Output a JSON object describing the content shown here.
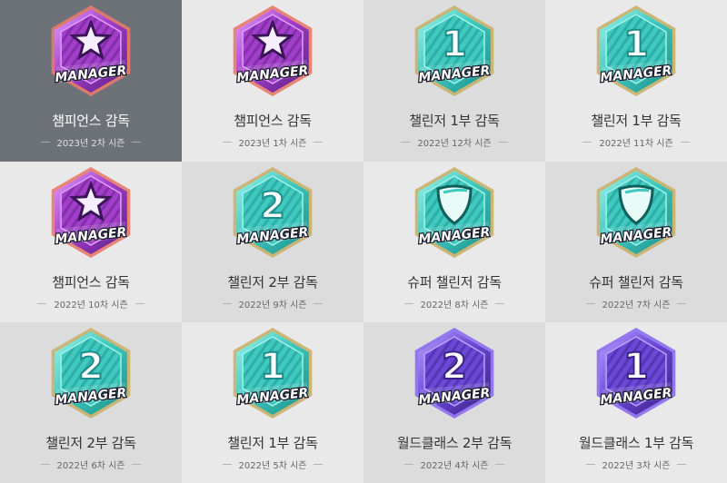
{
  "badges": [
    {
      "title": "챔피언스 감독",
      "season": "2023년 2차 시즌",
      "tier": "champions",
      "emblem": "star",
      "selected": true
    },
    {
      "title": "챔피언스 감독",
      "season": "2023년 1차 시즌",
      "tier": "champions",
      "emblem": "star",
      "selected": false
    },
    {
      "title": "챌린저 1부 감독",
      "season": "2022년 12차 시즌",
      "tier": "challenger",
      "emblem": "1",
      "selected": false
    },
    {
      "title": "챌린저 1부 감독",
      "season": "2022년 11차 시즌",
      "tier": "challenger",
      "emblem": "1",
      "selected": false
    },
    {
      "title": "챔피언스 감독",
      "season": "2022년 10차 시즌",
      "tier": "champions",
      "emblem": "star",
      "selected": false
    },
    {
      "title": "챌린저 2부 감독",
      "season": "2022년 9차 시즌",
      "tier": "challenger",
      "emblem": "2",
      "selected": false
    },
    {
      "title": "슈퍼 챌린저 감독",
      "season": "2022년 8차 시즌",
      "tier": "challenger",
      "emblem": "shield",
      "selected": false
    },
    {
      "title": "슈퍼 챌린저 감독",
      "season": "2022년 7차 시즌",
      "tier": "challenger",
      "emblem": "shield",
      "selected": false
    },
    {
      "title": "챌린저 2부 감독",
      "season": "2022년 6차 시즌",
      "tier": "challenger",
      "emblem": "2",
      "selected": false
    },
    {
      "title": "챌린저 1부 감독",
      "season": "2022년 5차 시즌",
      "tier": "challenger",
      "emblem": "1",
      "selected": false
    },
    {
      "title": "월드클래스 2부 감독",
      "season": "2022년 4차 시즌",
      "tier": "worldclass",
      "emblem": "2",
      "selected": false
    },
    {
      "title": "월드클래스 1부 감독",
      "season": "2022년 3차 시즌",
      "tier": "worldclass",
      "emblem": "1",
      "selected": false
    }
  ],
  "badge_banner_text": "MANAGER",
  "colors": {
    "champions": {
      "outer": "#5b1f86",
      "inner": "#a23ec9",
      "accent": "#e0a0ff",
      "rim": "#e87a6a"
    },
    "challenger": {
      "outer": "#1b8e89",
      "inner": "#3fc9bf",
      "accent": "#9ff3ea",
      "rim": "#c9b06a"
    },
    "worldclass": {
      "outer": "#3a1f8a",
      "inner": "#6b49d6",
      "accent": "#b9a2ff",
      "rim": "#8a6cf0"
    },
    "selected_bg": "#6d7178"
  }
}
